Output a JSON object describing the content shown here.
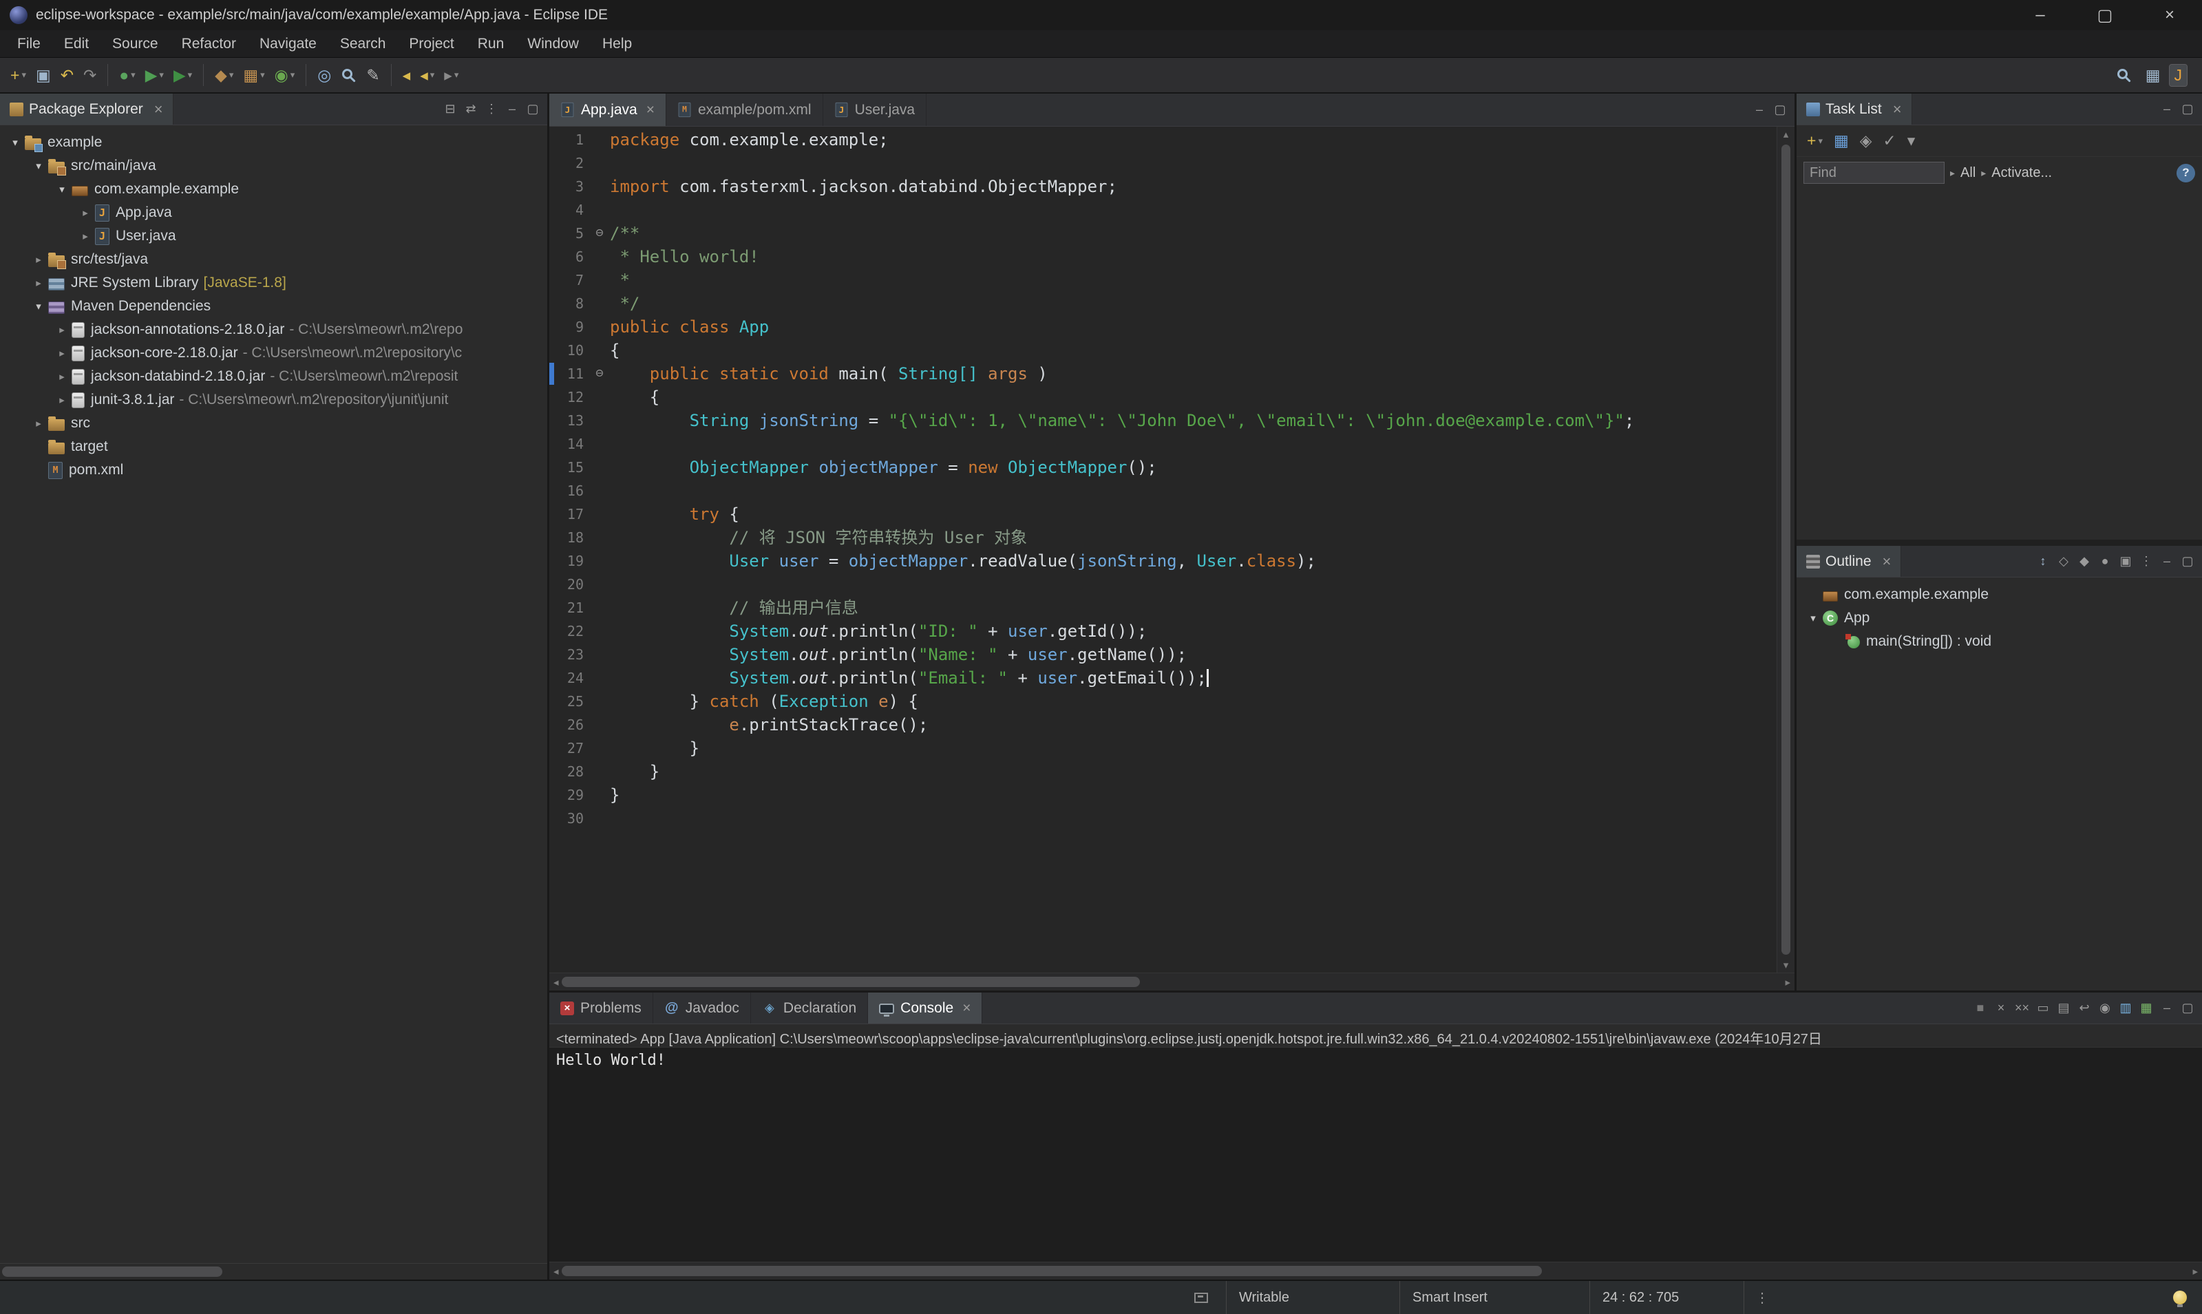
{
  "window": {
    "title": "eclipse-workspace - example/src/main/java/com/example/example/App.java - Eclipse IDE",
    "controls": [
      {
        "name": "minimize-button",
        "glyph": "–"
      },
      {
        "name": "maximize-button",
        "glyph": "▢"
      },
      {
        "name": "close-button",
        "glyph": "×"
      }
    ]
  },
  "glyphs": {
    "arrow_open": "▾",
    "arrow_closed": "▸",
    "dropdown": "▾",
    "fold": "⊖",
    "tab_close": "×",
    "scroll_up": "▴",
    "scroll_down": "▾",
    "scroll_left": "◂",
    "scroll_right": "▸"
  },
  "menubar": {
    "items": [
      "File",
      "Edit",
      "Source",
      "Refactor",
      "Navigate",
      "Search",
      "Project",
      "Run",
      "Window",
      "Help"
    ]
  },
  "toolbar": {
    "groups": [
      [
        {
          "name": "new-wizard-button",
          "glyph": "+",
          "color": "#d9b94d",
          "dd": true
        },
        {
          "name": "save-button",
          "glyph": "▣",
          "color": "#9fb6cc"
        },
        {
          "name": "undo-button",
          "glyph": "↶",
          "color": "#d9b94d"
        },
        {
          "name": "redo-button",
          "glyph": "↷",
          "color": "#8a8a8a"
        }
      ],
      [
        {
          "name": "debug-button",
          "glyph": "●",
          "color": "#5aa55e",
          "dd": true
        },
        {
          "name": "run-button",
          "glyph": "▶",
          "color": "#4f9e53",
          "dd": true
        },
        {
          "name": "run-external-tools-button",
          "glyph": "▶",
          "color": "#3f8f43",
          "dd": true
        }
      ],
      [
        {
          "name": "new-java-project-button",
          "glyph": "◆",
          "color": "#b58a50",
          "dd": true
        },
        {
          "name": "new-package-button",
          "glyph": "▦",
          "color": "#c08f4f",
          "dd": true
        },
        {
          "name": "new-class-button",
          "glyph": "◉",
          "color": "#6aa84f",
          "dd": true
        }
      ],
      [
        {
          "name": "open-type-button",
          "glyph": "◎",
          "color": "#8fb3d9"
        },
        {
          "name": "java-search-button",
          "mag": true
        },
        {
          "name": "mark-occurrences-button",
          "glyph": "✎",
          "color": "#b8b8b8"
        }
      ],
      [
        {
          "name": "last-edit-location-button",
          "glyph": "◂",
          "color": "#d9b94d"
        },
        {
          "name": "back-button",
          "glyph": "◂",
          "color": "#d9b94d",
          "dd": true
        },
        {
          "name": "forward-button",
          "glyph": "▸",
          "color": "#8a8a8a",
          "dd": true
        }
      ]
    ],
    "right": [
      {
        "name": "search-button",
        "mag": true
      },
      {
        "name": "open-perspective-button",
        "glyph": "▦",
        "color": "#9fb6cc"
      },
      {
        "name": "java-perspective-button",
        "glyph": "J",
        "color": "#e8a33d",
        "active": true
      }
    ]
  },
  "package_explorer": {
    "title": "Package Explorer",
    "close_glyph": "×",
    "header_icons": [
      {
        "name": "collapse-all-icon",
        "glyph": "⊟"
      },
      {
        "name": "link-with-editor-icon",
        "glyph": "⇄"
      },
      {
        "name": "view-menu-icon",
        "glyph": "⋮"
      },
      {
        "name": "minimize-view-icon",
        "glyph": "–"
      },
      {
        "name": "maximize-view-icon",
        "glyph": "▢"
      }
    ],
    "tree": [
      {
        "label": "example",
        "level": 0,
        "arrow": "open",
        "icon": "project"
      },
      {
        "label": "src/main/java",
        "level": 1,
        "arrow": "open",
        "icon": "srcfolder"
      },
      {
        "label": "com.example.example",
        "level": 2,
        "arrow": "open",
        "icon": "package"
      },
      {
        "label": "App.java",
        "level": 3,
        "arrow": "closed",
        "icon": "javafile"
      },
      {
        "label": "User.java",
        "level": 3,
        "arrow": "closed",
        "icon": "javafile"
      },
      {
        "label": "src/test/java",
        "level": 1,
        "arrow": "closed",
        "icon": "srcfolder"
      },
      {
        "label": "JRE System Library",
        "deco": "[JavaSE-1.8]",
        "deco_class": "ver",
        "level": 1,
        "arrow": "closed",
        "icon": "jre"
      },
      {
        "label": "Maven Dependencies",
        "level": 1,
        "arrow": "open",
        "icon": "mavendeps"
      },
      {
        "label": "jackson-annotations-2.18.0.jar",
        "deco": "- C:\\Users\\meowr\\.m2\\repo",
        "level": 2,
        "arrow": "closed",
        "icon": "jar"
      },
      {
        "label": "jackson-core-2.18.0.jar",
        "deco": "- C:\\Users\\meowr\\.m2\\repository\\c",
        "level": 2,
        "arrow": "closed",
        "icon": "jar"
      },
      {
        "label": "jackson-databind-2.18.0.jar",
        "deco": "- C:\\Users\\meowr\\.m2\\reposit",
        "level": 2,
        "arrow": "closed",
        "icon": "jar"
      },
      {
        "label": "junit-3.8.1.jar",
        "deco": "- C:\\Users\\meowr\\.m2\\repository\\junit\\junit",
        "level": 2,
        "arrow": "closed",
        "icon": "jar"
      },
      {
        "label": "src",
        "level": 1,
        "arrow": "closed",
        "icon": "folder"
      },
      {
        "label": "target",
        "level": 1,
        "arrow": null,
        "icon": "folder"
      },
      {
        "label": "pom.xml",
        "level": 1,
        "arrow": null,
        "icon": "xmlfile"
      }
    ]
  },
  "editor": {
    "tabs": [
      {
        "label": "App.java",
        "icon": "javafile",
        "active": true,
        "close": true
      },
      {
        "label": "example/pom.xml",
        "icon": "xmlfile",
        "active": false,
        "close": false
      },
      {
        "label": "User.java",
        "icon": "javafile",
        "active": false,
        "close": false
      }
    ],
    "header_icons": [
      {
        "name": "minimize-view-icon",
        "glyph": "–"
      },
      {
        "name": "maximize-view-icon",
        "glyph": "▢"
      }
    ],
    "lines": [
      {
        "n": 1,
        "segs": [
          [
            "package",
            "k"
          ],
          [
            " com.example.example;",
            "d"
          ]
        ]
      },
      {
        "n": 2,
        "segs": []
      },
      {
        "n": 3,
        "segs": [
          [
            "import",
            "k"
          ],
          [
            " com.fasterxml.jackson.databind.ObjectMapper;",
            "d"
          ]
        ]
      },
      {
        "n": 4,
        "segs": []
      },
      {
        "n": 5,
        "fold": true,
        "segs": [
          [
            "/**",
            "j"
          ]
        ]
      },
      {
        "n": 6,
        "segs": [
          [
            " * Hello world!",
            "j"
          ]
        ]
      },
      {
        "n": 7,
        "segs": [
          [
            " *",
            "j"
          ]
        ]
      },
      {
        "n": 8,
        "segs": [
          [
            " */",
            "j"
          ]
        ]
      },
      {
        "n": 9,
        "segs": [
          [
            "public class",
            "k"
          ],
          [
            " ",
            "d"
          ],
          [
            "App",
            "t"
          ]
        ]
      },
      {
        "n": 10,
        "segs": [
          [
            "{",
            "d"
          ]
        ]
      },
      {
        "n": 11,
        "fold": true,
        "mark": true,
        "segs": [
          [
            "    ",
            "d"
          ],
          [
            "public static void",
            "k"
          ],
          [
            " main( ",
            "d"
          ],
          [
            "String[]",
            "t"
          ],
          [
            " ",
            "d"
          ],
          [
            "args",
            "p"
          ],
          [
            " )",
            "d"
          ]
        ]
      },
      {
        "n": 12,
        "segs": [
          [
            "    {",
            "d"
          ]
        ]
      },
      {
        "n": 13,
        "segs": [
          [
            "        ",
            "d"
          ],
          [
            "String",
            "t"
          ],
          [
            " ",
            "d"
          ],
          [
            "jsonString",
            "v"
          ],
          [
            " = ",
            "d"
          ],
          [
            "\"{\\\"id\\\": 1, \\\"name\\\": \\\"John Doe\\\", \\\"email\\\": \\\"john.doe@example.com\\\"}\"",
            "s"
          ],
          [
            ";",
            "d"
          ]
        ]
      },
      {
        "n": 14,
        "segs": []
      },
      {
        "n": 15,
        "segs": [
          [
            "        ",
            "d"
          ],
          [
            "ObjectMapper",
            "t"
          ],
          [
            " ",
            "d"
          ],
          [
            "objectMapper",
            "v"
          ],
          [
            " = ",
            "d"
          ],
          [
            "new",
            "k"
          ],
          [
            " ",
            "d"
          ],
          [
            "ObjectMapper",
            "t"
          ],
          [
            "();",
            "d"
          ]
        ]
      },
      {
        "n": 16,
        "segs": []
      },
      {
        "n": 17,
        "segs": [
          [
            "        ",
            "d"
          ],
          [
            "try",
            "k"
          ],
          [
            " {",
            "d"
          ]
        ]
      },
      {
        "n": 18,
        "segs": [
          [
            "            ",
            "d"
          ],
          [
            "// 将 JSON 字符串转换为 User 对象",
            "c"
          ]
        ]
      },
      {
        "n": 19,
        "segs": [
          [
            "            ",
            "d"
          ],
          [
            "User",
            "t"
          ],
          [
            " ",
            "d"
          ],
          [
            "user",
            "v"
          ],
          [
            " = ",
            "d"
          ],
          [
            "objectMapper",
            "v"
          ],
          [
            ".readValue(",
            "d"
          ],
          [
            "jsonString",
            "v"
          ],
          [
            ", ",
            "d"
          ],
          [
            "User",
            "t"
          ],
          [
            ".",
            "d"
          ],
          [
            "class",
            "k"
          ],
          [
            ");",
            "d"
          ]
        ]
      },
      {
        "n": 20,
        "segs": []
      },
      {
        "n": 21,
        "segs": [
          [
            "            ",
            "d"
          ],
          [
            "// 输出用户信息",
            "c"
          ]
        ]
      },
      {
        "n": 22,
        "segs": [
          [
            "            ",
            "d"
          ],
          [
            "System",
            "t"
          ],
          [
            ".",
            "d"
          ],
          [
            "out",
            "f"
          ],
          [
            ".println(",
            "d"
          ],
          [
            "\"ID: \"",
            "s"
          ],
          [
            " + ",
            "d"
          ],
          [
            "user",
            "v"
          ],
          [
            ".getId());",
            "d"
          ]
        ]
      },
      {
        "n": 23,
        "segs": [
          [
            "            ",
            "d"
          ],
          [
            "System",
            "t"
          ],
          [
            ".",
            "d"
          ],
          [
            "out",
            "f"
          ],
          [
            ".println(",
            "d"
          ],
          [
            "\"Name: \"",
            "s"
          ],
          [
            " + ",
            "d"
          ],
          [
            "user",
            "v"
          ],
          [
            ".getName());",
            "d"
          ]
        ]
      },
      {
        "n": 24,
        "cursor": true,
        "segs": [
          [
            "            ",
            "d"
          ],
          [
            "System",
            "t"
          ],
          [
            ".",
            "d"
          ],
          [
            "out",
            "f"
          ],
          [
            ".println(",
            "d"
          ],
          [
            "\"Email: \"",
            "s"
          ],
          [
            " + ",
            "d"
          ],
          [
            "user",
            "v"
          ],
          [
            ".getEmail());",
            "d"
          ]
        ]
      },
      {
        "n": 25,
        "segs": [
          [
            "        } ",
            "d"
          ],
          [
            "catch",
            "k"
          ],
          [
            " (",
            "d"
          ],
          [
            "Exception",
            "t"
          ],
          [
            " ",
            "d"
          ],
          [
            "e",
            "p"
          ],
          [
            ") {",
            "d"
          ]
        ]
      },
      {
        "n": 26,
        "segs": [
          [
            "            ",
            "d"
          ],
          [
            "e",
            "p"
          ],
          [
            ".printStackTrace();",
            "d"
          ]
        ]
      },
      {
        "n": 27,
        "segs": [
          [
            "        }",
            "d"
          ]
        ]
      },
      {
        "n": 28,
        "segs": [
          [
            "    }",
            "d"
          ]
        ]
      },
      {
        "n": 29,
        "segs": [
          [
            "}",
            "d"
          ]
        ]
      },
      {
        "n": 30,
        "segs": []
      }
    ]
  },
  "task_list": {
    "title": "Task List",
    "close_glyph": "×",
    "header_icons": [
      {
        "name": "minimize-view-icon",
        "glyph": "–"
      },
      {
        "name": "maximize-view-icon",
        "glyph": "▢"
      }
    ],
    "toolbar_icons": [
      {
        "name": "new-task-button",
        "glyph": "+",
        "color": "#d9b94d",
        "dd": true
      },
      {
        "name": "categorized-view-button",
        "glyph": "▦",
        "color": "#6a9fd8"
      },
      {
        "name": "filter-button",
        "glyph": "◈",
        "color": "#9a9a9a"
      },
      {
        "name": "hide-completed-button",
        "glyph": "✓",
        "color": "#9a9a9a"
      },
      {
        "name": "view-menu-dropdown-button",
        "glyph": "▾",
        "color": "#9a9a9a"
      }
    ],
    "find_placeholder": "Find",
    "chevron": "▸",
    "scope_all": "All",
    "activate_label": "Activate...",
    "help_glyph": "?"
  },
  "outline": {
    "title": "Outline",
    "close_glyph": "×",
    "header_icons": [
      {
        "name": "sort-icon",
        "glyph": "↕",
        "color": "#9fb6cc"
      },
      {
        "name": "hide-fields-icon",
        "glyph": "◇"
      },
      {
        "name": "hide-static-members-icon",
        "glyph": "◆"
      },
      {
        "name": "hide-non-public-icon",
        "glyph": "●"
      },
      {
        "name": "hide-local-types-icon",
        "glyph": "▣"
      },
      {
        "name": "view-menu-icon",
        "glyph": "⋮"
      },
      {
        "name": "minimize-view-icon",
        "glyph": "–"
      },
      {
        "name": "maximize-view-icon",
        "glyph": "▢"
      }
    ],
    "items": [
      {
        "label": "com.example.example",
        "icon": "package",
        "level": 0,
        "arrow": null
      },
      {
        "label": "App",
        "icon": "class",
        "level": 0,
        "arrow": "open"
      },
      {
        "label": "main(String[]) : void",
        "icon": "method",
        "level": 1,
        "arrow": null
      }
    ]
  },
  "bottom": {
    "tabs": [
      {
        "label": "Problems",
        "icon": "problems",
        "active": false,
        "close": false
      },
      {
        "label": "Javadoc",
        "icon": "javadoc",
        "active": false,
        "close": false
      },
      {
        "label": "Declaration",
        "icon": "declaration",
        "active": false,
        "close": false
      },
      {
        "label": "Console",
        "icon": "console",
        "active": true,
        "close": true
      }
    ],
    "toolbar_icons": [
      {
        "name": "terminate-icon",
        "glyph": "■",
        "color": "#777777"
      },
      {
        "name": "remove-launch-icon",
        "glyph": "×",
        "color": "#9a9a9a"
      },
      {
        "name": "remove-all-launches-icon",
        "glyph": "××",
        "color": "#9a9a9a"
      },
      {
        "name": "clear-console-icon",
        "glyph": "▭",
        "color": "#9a9a9a"
      },
      {
        "name": "scroll-lock-icon",
        "glyph": "▤",
        "color": "#9a9a9a"
      },
      {
        "name": "word-wrap-icon",
        "glyph": "↩",
        "color": "#9a9a9a"
      },
      {
        "name": "pin-console-icon",
        "glyph": "◉",
        "color": "#9a9a9a"
      },
      {
        "name": "display-selected-console-icon",
        "glyph": "▥",
        "color": "#7ab3e0"
      },
      {
        "name": "open-console-icon",
        "glyph": "▦",
        "color": "#7cba6a"
      },
      {
        "name": "minimize-view-icon",
        "glyph": "–",
        "color": "#9a9a9a"
      },
      {
        "name": "maximize-view-icon",
        "glyph": "▢",
        "color": "#9a9a9a"
      }
    ],
    "console_label": "<terminated> App [Java Application] C:\\Users\\meowr\\scoop\\apps\\eclipse-java\\current\\plugins\\org.eclipse.justj.openjdk.hotspot.jre.full.win32.x86_64_21.0.4.v20240802-1551\\jre\\bin\\javaw.exe (2024年10月27日",
    "console_output": "Hello World!"
  },
  "status_bar": {
    "writable": "Writable",
    "insert_mode": "Smart Insert",
    "position": "24 : 62 : 705",
    "menu_glyph": "⋮"
  }
}
